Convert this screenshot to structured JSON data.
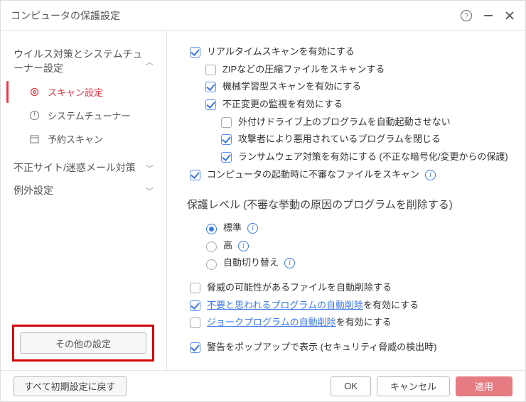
{
  "title": "コンピュータの保護設定",
  "sidebar": {
    "section1": {
      "title": "ウイルス対策とシステムチューナー設定",
      "items": [
        {
          "label": "スキャン設定"
        },
        {
          "label": "システムチューナー"
        },
        {
          "label": "予約スキャン"
        }
      ]
    },
    "section2": {
      "title": "不正サイト/迷惑メール対策"
    },
    "section3": {
      "title": "例外設定"
    },
    "other_btn": "その他の設定"
  },
  "content": {
    "cb_realtime": "リアルタイムスキャンを有効にする",
    "cb_zip": "ZIPなどの圧縮ファイルをスキャンする",
    "cb_ml": "機械学習型スキャンを有効にする",
    "cb_tamper": "不正変更の監視を有効にする",
    "cb_ext_drive": "外付けドライブ上のプログラムを自動起動させない",
    "cb_attacker": "攻撃者により悪用されているプログラムを閉じる",
    "cb_ransom_label": "ランサムウェア対策を有効にする ",
    "cb_ransom_paren": "(不正な暗号化/変更からの保護)",
    "cb_startup": "コンピュータの起動時に不審なファイルをスキャン",
    "level_header": "保護レベル (不審な挙動の原因のプログラムを削除する)",
    "r_std": "標準",
    "r_high": "高",
    "r_auto": "自動切り替え",
    "cb_threat_del": "脅威の可能性があるファイルを自動削除する",
    "link_pup": "不要と思われるプログラムの自動削除",
    "cb_pup_suffix": "を有効にする",
    "link_joke": "ジョークプログラムの自動削除",
    "cb_joke_suffix": "を有効にする",
    "cb_popup": "警告をポップアップで表示 (セキュリティ脅威の検出時)"
  },
  "footer": {
    "reset": "すべて初期設定に戻す",
    "ok": "OK",
    "cancel": "キャンセル",
    "apply": "適用"
  }
}
